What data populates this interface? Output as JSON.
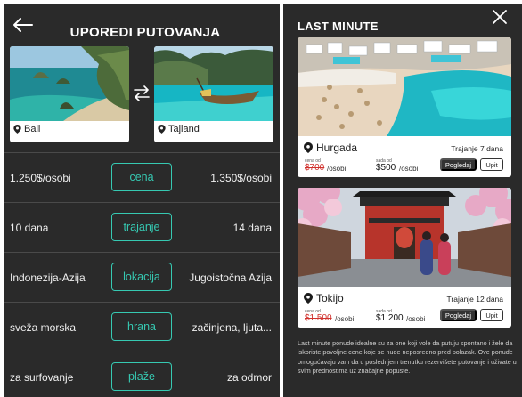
{
  "compare": {
    "title": "UPOREDI PUTOVANJA",
    "dest_a": "Bali",
    "dest_b": "Tajland",
    "rows": [
      {
        "left": "1.250$/osobi",
        "label": "cena",
        "right": "1.350$/osobi"
      },
      {
        "left": "10 dana",
        "label": "trajanje",
        "right": "14 dana"
      },
      {
        "left": "Indonezija-Azija",
        "label": "lokacija",
        "right": "Jugoistočna Azija"
      },
      {
        "left": "sveža morska",
        "label": "hrana",
        "right": "začinjena, ljuta..."
      },
      {
        "left": "za surfovanje",
        "label": "plaže",
        "right": "za odmor"
      }
    ]
  },
  "last_minute": {
    "title": "LAST MINUTE",
    "offers": [
      {
        "city": "Hurgada",
        "duration": "Trajanje 7 dana",
        "old_label": "cena od",
        "old_price": "$700",
        "old_unit": "/osobi",
        "new_label": "sada od",
        "new_price": "$500",
        "new_unit": "/osobi",
        "view_label": "Pogledaj",
        "ask_label": "Upit"
      },
      {
        "city": "Tokijo",
        "duration": "Trajanje 12 dana",
        "old_label": "cena od",
        "old_price": "$1.500",
        "old_unit": "/osobi",
        "new_label": "sada od",
        "new_price": "$1.200",
        "new_unit": "/osobi",
        "view_label": "Pogledaj",
        "ask_label": "Upit"
      }
    ],
    "description": "Last minute ponude idealne su za one koji vole da putuju spontano i žele da iskoriste povoljne cene koje se nude neposredno pred polazak. Ove ponude omogućavaju vam da u poslednjem trenutku rezervišete putovanje i uživate u svim prednostima uz značajne popuste."
  },
  "colors": {
    "background": "#2a2a2a",
    "accent": "#36c9b2",
    "old_price": "#d0302c"
  },
  "icons": [
    "back-arrow-icon",
    "swap-arrows-icon",
    "location-pin-icon",
    "close-icon"
  ]
}
